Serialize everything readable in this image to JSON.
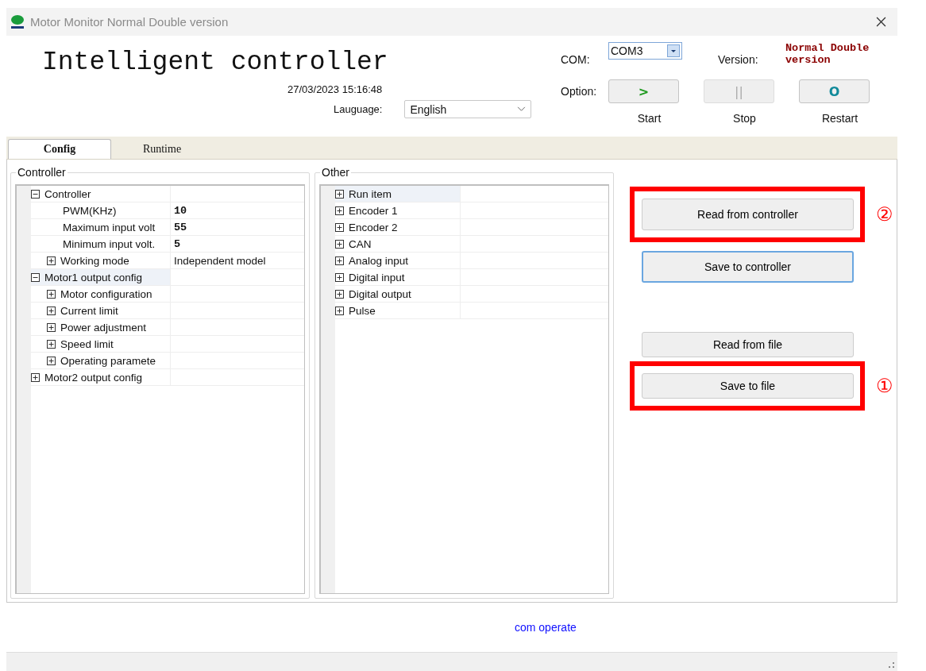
{
  "window": {
    "title": "Motor Monitor Normal Double version"
  },
  "header": {
    "title": "Intelligent controller",
    "datetime": "27/03/2023 15:16:48",
    "language_label": "Lauguage:",
    "language": {
      "value": "English"
    },
    "com_label": "COM:",
    "com": {
      "value": "COM3"
    },
    "version_label": "Version:",
    "version": "Normal Double version",
    "option_label": "Option:",
    "options": [
      {
        "glyph": ">",
        "label": "Start",
        "kind": "start",
        "disabled": false
      },
      {
        "glyph": "||",
        "label": "Stop",
        "kind": "stop",
        "disabled": true
      },
      {
        "glyph": "O",
        "label": "Restart",
        "kind": "restart",
        "disabled": false
      }
    ]
  },
  "tabs": [
    {
      "label": "Config",
      "selected": true
    },
    {
      "label": "Runtime",
      "selected": false
    }
  ],
  "groups": [
    {
      "title": "Controller",
      "tree": [
        {
          "label": "Controller",
          "kind": "group",
          "expanded": true,
          "selected": false,
          "children": [
            {
              "label": "PWM(KHz)",
              "kind": "leaf",
              "value": "10",
              "selected": false
            },
            {
              "label": "Maximum input volt",
              "kind": "leaf",
              "value": "55",
              "selected": false
            },
            {
              "label": "Minimum input volt.",
              "kind": "leaf",
              "value": "5",
              "selected": false
            },
            {
              "label": "Working mode",
              "kind": "group",
              "expanded": false,
              "value": "Independent model",
              "selected": false
            }
          ]
        },
        {
          "label": "Motor1 output config",
          "kind": "group",
          "expanded": true,
          "selected": true,
          "children": [
            {
              "label": "Motor configuration",
              "kind": "group",
              "expanded": false,
              "selected": false
            },
            {
              "label": "Current limit",
              "kind": "group",
              "expanded": false,
              "selected": false
            },
            {
              "label": "Power adjustment",
              "kind": "group",
              "expanded": false,
              "selected": false
            },
            {
              "label": "Speed limit",
              "kind": "group",
              "expanded": false,
              "selected": false
            },
            {
              "label": "Operating paramete",
              "kind": "group",
              "expanded": false,
              "selected": false
            }
          ]
        },
        {
          "label": "Motor2 output config",
          "kind": "group",
          "expanded": false,
          "selected": false
        }
      ]
    },
    {
      "title": "Other",
      "tree": [
        {
          "label": "Run item",
          "kind": "group",
          "expanded": false,
          "selected": true
        },
        {
          "label": "Encoder 1",
          "kind": "group",
          "expanded": false,
          "selected": false
        },
        {
          "label": "Encoder 2",
          "kind": "group",
          "expanded": false,
          "selected": false
        },
        {
          "label": "CAN",
          "kind": "group",
          "expanded": false,
          "selected": false
        },
        {
          "label": "Analog input",
          "kind": "group",
          "expanded": false,
          "selected": false
        },
        {
          "label": "Digital input",
          "kind": "group",
          "expanded": false,
          "selected": false
        },
        {
          "label": "Digital output",
          "kind": "group",
          "expanded": false,
          "selected": false
        },
        {
          "label": "Pulse",
          "kind": "group",
          "expanded": false,
          "selected": false
        }
      ]
    }
  ],
  "actions": [
    {
      "label": "Read from controller",
      "focused": false,
      "marker": "②"
    },
    {
      "label": "Save to controller",
      "focused": true
    },
    {
      "label": "Read from file",
      "focused": false
    },
    {
      "label": "Save to file",
      "focused": false,
      "marker": "①"
    }
  ],
  "status_message": "com operate"
}
